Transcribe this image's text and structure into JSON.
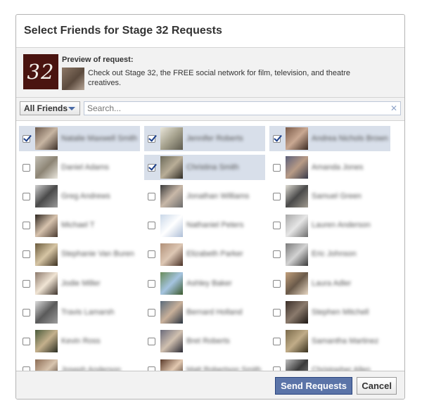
{
  "dialog": {
    "title": "Select Friends for Stage 32 Requests",
    "preview_heading": "Preview of request:",
    "app_logo_text": "32",
    "preview_message": "Check out Stage 32, the FREE social network for film, television, and theatre creatives."
  },
  "filter": {
    "selected": "All Friends",
    "search_placeholder": "Search..."
  },
  "friends": [
    {
      "name": "Natalie Maxwell Smith",
      "checked": true,
      "colors": [
        "#6d5a4c",
        "#c7b5a2",
        "#3c3029"
      ]
    },
    {
      "name": "Jennifer Roberts",
      "checked": true,
      "colors": [
        "#e9e6da",
        "#a6a28e",
        "#5d5a4e"
      ]
    },
    {
      "name": "Andrea Nichols Brown",
      "checked": true,
      "colors": [
        "#7a5a48",
        "#c9a892",
        "#3b2a22"
      ]
    },
    {
      "name": "Daniel Adams",
      "checked": false,
      "colors": [
        "#c5c1b7",
        "#8d8575",
        "#ebe8df"
      ]
    },
    {
      "name": "Christina Smith",
      "checked": true,
      "colors": [
        "#6c6a5a",
        "#b8ad97",
        "#2f2b25"
      ]
    },
    {
      "name": "Amanda Jones",
      "checked": false,
      "colors": [
        "#5b5f7a",
        "#b89b86",
        "#383a4a"
      ]
    },
    {
      "name": "Greg Andrews",
      "checked": false,
      "colors": [
        "#d0d0d0",
        "#4a4a4a",
        "#9a9a9a"
      ]
    },
    {
      "name": "Jonathan Williams",
      "checked": false,
      "colors": [
        "#3a3a3a",
        "#c8b8a8",
        "#6c6c6c"
      ]
    },
    {
      "name": "Samuel Green",
      "checked": false,
      "colors": [
        "#e0ddd5",
        "#4a4a4a",
        "#a09a90"
      ]
    },
    {
      "name": "Michael T",
      "checked": false,
      "colors": [
        "#2e2620",
        "#d6c2ad",
        "#4a3b30"
      ]
    },
    {
      "name": "Nathaniel Peters",
      "checked": false,
      "colors": [
        "#c9d7e8",
        "#ffffff",
        "#aebfd7"
      ]
    },
    {
      "name": "Lauren Anderson",
      "checked": false,
      "colors": [
        "#a8a8a8",
        "#e6e6e6",
        "#6c6c6c"
      ]
    },
    {
      "name": "Stephanie Van Buren",
      "checked": false,
      "colors": [
        "#6a5a3c",
        "#d6c5a4",
        "#3c3020"
      ]
    },
    {
      "name": "Elizabeth Parker",
      "checked": false,
      "colors": [
        "#b09078",
        "#ddc7b4",
        "#4a3228"
      ]
    },
    {
      "name": "Eric Johnson",
      "checked": false,
      "colors": [
        "#7a7a7a",
        "#d2d2d2",
        "#3a3a3a"
      ]
    },
    {
      "name": "Jodie Miller",
      "checked": false,
      "colors": [
        "#8c7a6c",
        "#f0e4d4",
        "#3e342c"
      ]
    },
    {
      "name": "Ashley Baker",
      "checked": false,
      "colors": [
        "#6a8c5a",
        "#a5c4e0",
        "#3c5a2e"
      ]
    },
    {
      "name": "Laura Adler",
      "checked": false,
      "colors": [
        "#c2a07c",
        "#6a5a4a",
        "#e8d8c4"
      ]
    },
    {
      "name": "Travis Lamarsh",
      "checked": false,
      "colors": [
        "#dcdcdc",
        "#5a5a5a",
        "#9c9c9c"
      ]
    },
    {
      "name": "Bernard Holland",
      "checked": false,
      "colors": [
        "#5a6a7a",
        "#c8b09a",
        "#2a3440"
      ]
    },
    {
      "name": "Stephen Mitchell",
      "checked": false,
      "colors": [
        "#3a2e28",
        "#8a7a6c",
        "#1e1814"
      ]
    },
    {
      "name": "Kevin Ross",
      "checked": false,
      "colors": [
        "#4a5a3a",
        "#c4b08c",
        "#2a2e22"
      ]
    },
    {
      "name": "Bret Roberts",
      "checked": false,
      "colors": [
        "#6a6a7a",
        "#d0c0b0",
        "#2a2a34"
      ]
    },
    {
      "name": "Samantha Martinez",
      "checked": false,
      "colors": [
        "#7a6a4a",
        "#c0ac88",
        "#3a321e"
      ]
    },
    {
      "name": "Joseph Anderson",
      "checked": false,
      "colors": [
        "#8c6c54",
        "#d8c4ae",
        "#3c2e24"
      ]
    },
    {
      "name": "Matt Robertson Smith",
      "checked": false,
      "colors": [
        "#5a3a2a",
        "#e2c8b0",
        "#2a1a12"
      ]
    },
    {
      "name": "Christopher Allen",
      "checked": false,
      "colors": [
        "#c0c0c0",
        "#3a3a3a",
        "#8a8a8a"
      ]
    }
  ],
  "footer": {
    "send_label": "Send Requests",
    "cancel_label": "Cancel"
  },
  "colors": {
    "selected_row": "#d8dfea",
    "send_button": "#5b74a8",
    "logo_bg": "#4a1410"
  }
}
